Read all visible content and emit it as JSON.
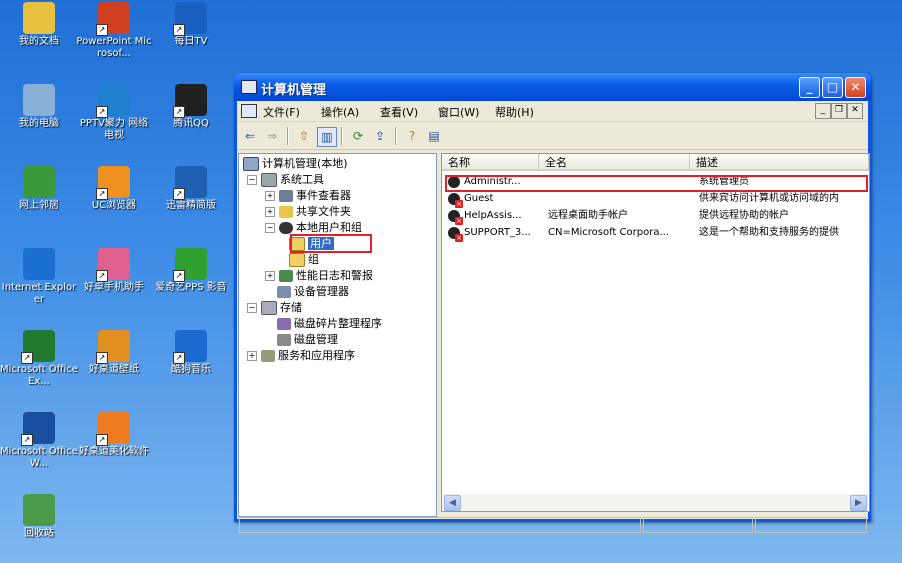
{
  "desktop": {
    "icons": [
      {
        "label": "我的文档",
        "icon": "my-documents-icon",
        "shortcut": false
      },
      {
        "label": "PowerPoint Microsof...",
        "icon": "powerpoint-icon",
        "shortcut": true
      },
      {
        "label": "每日TV",
        "icon": "tv-app-icon",
        "shortcut": true
      },
      {
        "label": "我的电脑",
        "icon": "my-computer-icon",
        "shortcut": false
      },
      {
        "label": "PPTV聚力 网络电视",
        "icon": "pptv-icon",
        "shortcut": true
      },
      {
        "label": "腾讯QQ",
        "icon": "qq-icon",
        "shortcut": true
      },
      {
        "label": "网上邻居",
        "icon": "network-places-icon",
        "shortcut": false
      },
      {
        "label": "UC浏览器",
        "icon": "uc-browser-icon",
        "shortcut": true
      },
      {
        "label": "迅雷精简版",
        "icon": "thunder-icon",
        "shortcut": true
      },
      {
        "label": "Internet Explorer",
        "icon": "internet-explorer-icon",
        "shortcut": false
      },
      {
        "label": "好卓手机助手",
        "icon": "phone-assistant-icon",
        "shortcut": true
      },
      {
        "label": "爱奇艺PPS 影音",
        "icon": "iqiyi-icon",
        "shortcut": true
      },
      {
        "label": "Microsoft Office Ex...",
        "icon": "excel-icon",
        "shortcut": true
      },
      {
        "label": "好桌道壁纸",
        "icon": "wallpaper-app-icon",
        "shortcut": true
      },
      {
        "label": "酷狗音乐",
        "icon": "kugou-icon",
        "shortcut": true
      },
      {
        "label": "Microsoft Office W...",
        "icon": "word-icon",
        "shortcut": true
      },
      {
        "label": "好桌道美化软件",
        "icon": "beautify-app-icon",
        "shortcut": true
      },
      {
        "label": "回收站",
        "icon": "recycle-bin-icon",
        "shortcut": false
      }
    ]
  },
  "window": {
    "title": "计算机管理",
    "buttons": {
      "minimize": "_",
      "maximize": "□",
      "close": "✕"
    },
    "menu": [
      "文件(F)",
      "操作(A)",
      "查看(V)",
      "窗口(W)",
      "帮助(H)"
    ],
    "tree": {
      "root": "计算机管理(本地)",
      "system_tools": "系统工具",
      "event_viewer": "事件查看器",
      "shared_folders": "共享文件夹",
      "local_users_groups": "本地用户和组",
      "users": "用户",
      "groups": "组",
      "perf_logs": "性能日志和警报",
      "device_manager": "设备管理器",
      "storage": "存储",
      "defrag": "磁盘碎片整理程序",
      "disk_mgmt": "磁盘管理",
      "services_apps": "服务和应用程序"
    },
    "list": {
      "columns": [
        "名称",
        "全名",
        "描述"
      ],
      "rows": [
        {
          "name": "Administr...",
          "fullname": "",
          "desc": "系统管理员",
          "disabled": false
        },
        {
          "name": "Guest",
          "fullname": "",
          "desc": "供来宾访问计算机或访问域的内",
          "disabled": true
        },
        {
          "name": "HelpAssis...",
          "fullname": "远程桌面助手帐户",
          "desc": "提供远程协助的帐户",
          "disabled": true
        },
        {
          "name": "SUPPORT_3...",
          "fullname": "CN=Microsoft Corpora...",
          "desc": "这是一个帮助和支持服务的提供",
          "disabled": true
        }
      ]
    }
  },
  "colors": {
    "highlight_red": "#e0202a",
    "selection": "#316ac5",
    "title_blue": "#0a56e0"
  }
}
